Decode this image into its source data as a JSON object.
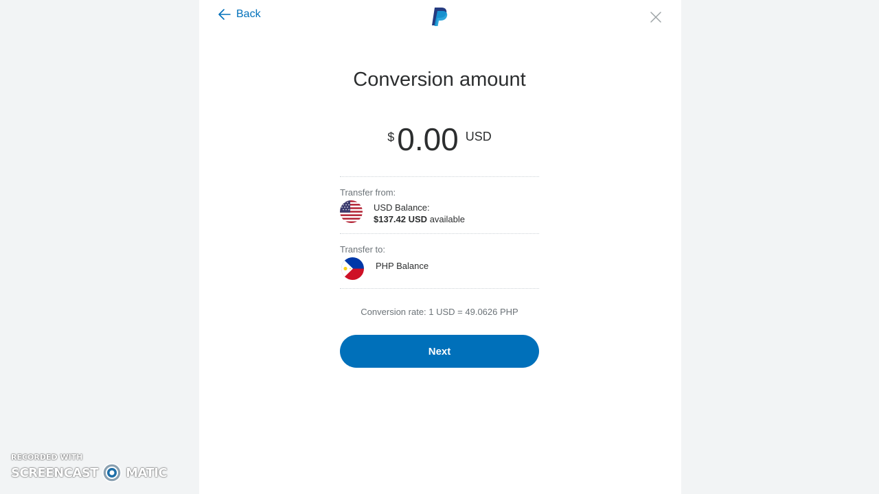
{
  "header": {
    "back_label": "Back"
  },
  "title": "Conversion amount",
  "amount": {
    "symbol": "$",
    "value": "0.00",
    "currency": "USD"
  },
  "transfer_from": {
    "label": "Transfer from:",
    "account_name": "USD Balance:",
    "available_amount": "$137.42 USD",
    "available_suffix": "available",
    "flag": "us-flag-icon"
  },
  "transfer_to": {
    "label": "Transfer to:",
    "account_name": "PHP Balance",
    "flag": "ph-flag-icon"
  },
  "conversion_rate": "Conversion rate: 1 USD = 49.0626 PHP",
  "next_button": "Next",
  "watermark": {
    "line1": "RECORDED WITH",
    "brand_left": "SCREENCAST",
    "brand_right": "MATIC"
  },
  "colors": {
    "accent": "#0070ba",
    "text": "#2c2e2f",
    "muted": "#6c7378",
    "background": "#f2f4f5"
  }
}
